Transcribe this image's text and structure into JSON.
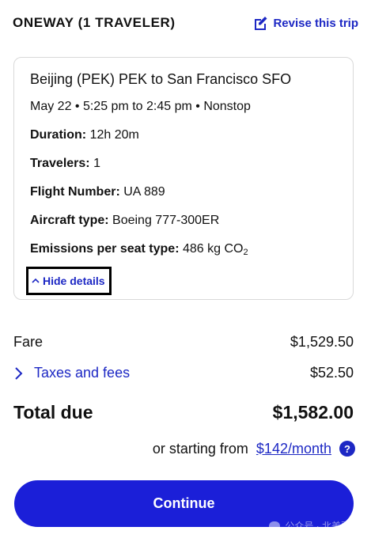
{
  "header": {
    "trip_type": "ONEWAY (1 TRAVELER)",
    "revise_label": "Revise this trip"
  },
  "details": {
    "route": "Beijing (PEK) PEK to San Francisco SFO",
    "schedule": "May 22 • 5:25 pm to 2:45 pm • Nonstop",
    "duration_label": "Duration:",
    "duration_value": "12h 20m",
    "travelers_label": "Travelers:",
    "travelers_value": "1",
    "flight_number_label": "Flight Number:",
    "flight_number_value": "UA 889",
    "aircraft_label": "Aircraft type:",
    "aircraft_value": "Boeing 777-300ER",
    "emissions_label": "Emissions per seat type:",
    "emissions_value": "486 kg CO",
    "emissions_sub": "2",
    "hide_details_label": "Hide details"
  },
  "pricing": {
    "fare_label": "Fare",
    "fare_value": "$1,529.50",
    "taxes_label": "Taxes and fees",
    "taxes_value": "$52.50",
    "total_label": "Total due",
    "total_value": "$1,582.00",
    "starting_text": "or starting from",
    "monthly_link": "$142/month",
    "help_glyph": "?"
  },
  "actions": {
    "continue_label": "Continue"
  },
  "watermark": {
    "text": "公众号 · 北美票帝"
  },
  "colors": {
    "accent": "#1d28c4",
    "button": "#1b1fd8"
  }
}
